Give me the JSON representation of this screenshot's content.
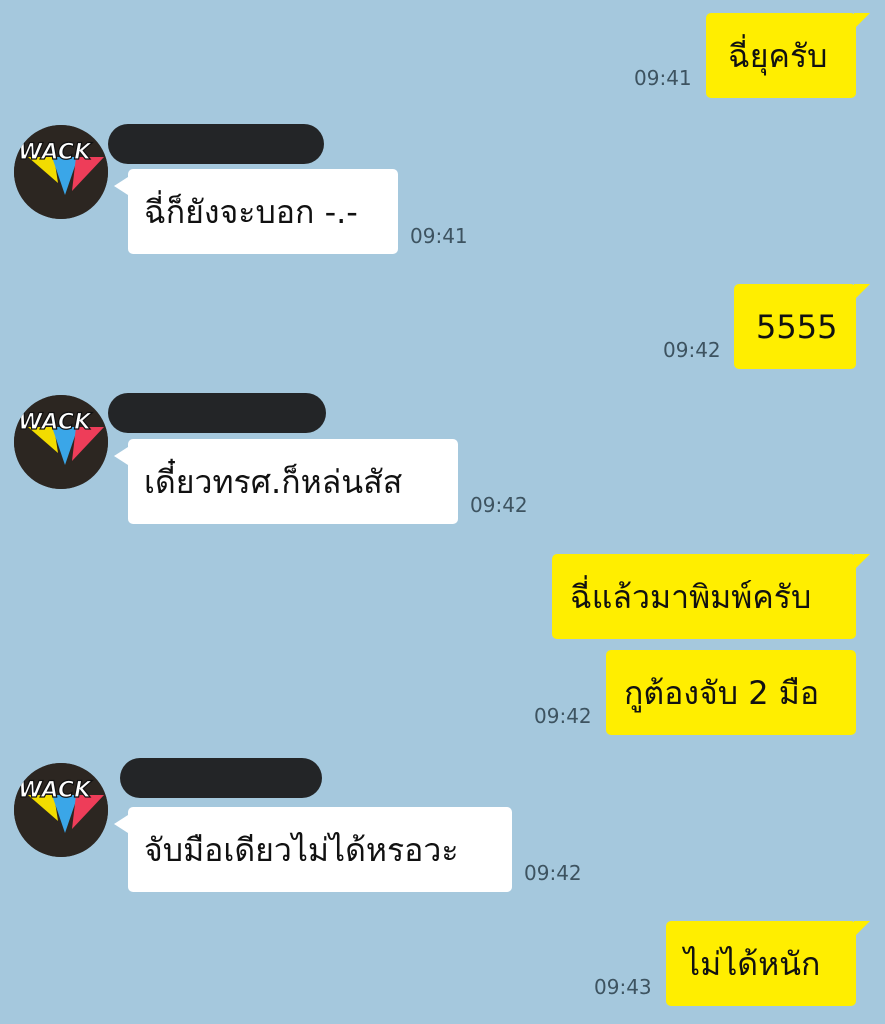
{
  "contact": {
    "avatar_text": "WACK"
  },
  "messages": [
    {
      "id": 1,
      "side": "out",
      "text": "ฉี่ยุครับ",
      "time": "09:41"
    },
    {
      "id": 2,
      "side": "in",
      "text": "ฉี่ก็ยังจะบอก -.-",
      "time": "09:41"
    },
    {
      "id": 3,
      "side": "out",
      "text": "5555",
      "time": "09:42"
    },
    {
      "id": 4,
      "side": "in",
      "text": "เดี๋ยวทรศ.ก็หล่นสัส",
      "time": "09:42"
    },
    {
      "id": 5,
      "side": "out",
      "text": "ฉี่แล้วมาพิมพ์ครับ",
      "time": ""
    },
    {
      "id": 6,
      "side": "out",
      "text": "กูต้องจับ 2 มือ",
      "time": "09:42"
    },
    {
      "id": 7,
      "side": "in",
      "text": "จับมือเดียวไม่ได้หรอวะ",
      "time": "09:42"
    },
    {
      "id": 8,
      "side": "out",
      "text": "ไม่ได้หนัก",
      "time": "09:43"
    }
  ],
  "colors": {
    "background": "#a5c8dd",
    "outgoing_bubble": "#ffee00",
    "incoming_bubble": "#ffffff",
    "timestamp": "#3d5360"
  }
}
